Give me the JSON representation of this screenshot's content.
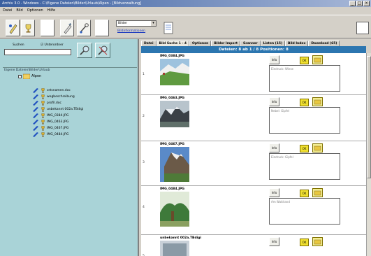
{
  "window": {
    "title": "Archiv 3.0 - Windows - C:\\Eigene Dateien\\Bilder\\Urlaub\\Alpen - [Bildverwaltung]",
    "controls": [
      "_",
      "□",
      "×"
    ]
  },
  "menu": [
    "Datei",
    "Bild",
    "Optionen",
    "Hilfe"
  ],
  "toolbar": {
    "select_value": "Bilder",
    "link_label": "Bildinformationen"
  },
  "left": {
    "search_label": "Suchen",
    "subfolder_label": "Unterordner",
    "search_value": "",
    "tree_path": "Eigene Dateien\\Bilder\\Urlaub",
    "root_label": "Alpen",
    "items": [
      "ortsnamen.doc",
      "wegbeschreibung",
      "profil.doc",
      "unbekannt 002a.TBdigi",
      "IMG_0384.JPG",
      "IMG_0463.JPG",
      "IMG_0467.JPG",
      "IMG_0484.JPG"
    ]
  },
  "right": {
    "tabs": [
      "Datei",
      "Bild Suche 1 - 4",
      "Optionen",
      "Bilder Import",
      "Scanner",
      "Listen (15)",
      "Bild Index",
      "Download (65)"
    ],
    "status": "Dateien: 8   ab 1 / 8 Positionen: 8",
    "rows": [
      {
        "num": "1",
        "file": "IMG_0384.JPG",
        "note": "Eindruck: Wiese"
      },
      {
        "num": "2",
        "file": "IMG_0463.JPG",
        "note": "Nebel: Gipfel"
      },
      {
        "num": "3",
        "file": "IMG_0467.JPG",
        "note": "Eindruck: Gipfel"
      },
      {
        "num": "4",
        "file": "IMG_0484.JPG",
        "note": "Am Waldrand"
      },
      {
        "num": "5",
        "file": "unbekannt 002a.TBdigi",
        "note": ""
      }
    ],
    "btn_label": "Info",
    "ok_label": "OK"
  },
  "colors": {
    "left_panel": "#a9d3d7",
    "status_bar": "#2c76b0",
    "titlebar": "#3a5fa0"
  }
}
